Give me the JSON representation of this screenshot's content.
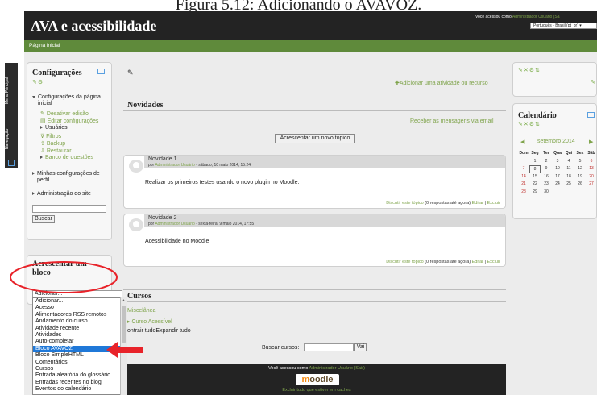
{
  "caption": "Figura 5.12: Adicionando o AVAVOZ.",
  "header": {
    "site_title": "AVA e acessibilidade",
    "login_prefix": "Você acessou como ",
    "login_user": "Administrador Usuário",
    "login_suffix": " (Sa",
    "language": "Português - Brasil (pt_br)"
  },
  "navbar": {
    "home": "Página inicial"
  },
  "side_tabs": {
    "main_menu": "Menu Principal",
    "navigation": "Navegação"
  },
  "config_block": {
    "title": "Configurações",
    "root": "Configurações da página inicial",
    "items": [
      "Desativar edição",
      "Editar configurações",
      "Usuários",
      "Filtros",
      "Backup",
      "Restaurar",
      "Banco de questões"
    ],
    "my_profile": "Minhas configurações de perfil",
    "site_admin": "Administração do site",
    "search_button": "Buscar"
  },
  "add_block": {
    "title_line1": "Acrescentar um",
    "title_line2": "bloco",
    "select_value": "Adicionar...",
    "options": [
      "Adicionar...",
      "Acesso",
      "Alimentadores RSS remotos",
      "Andamento do curso",
      "Atividade recente",
      "Atividades",
      "Auto-completar",
      "Bloco AVAVOZ",
      "Bloco SimpleHTML",
      "Comentários",
      "Cursos",
      "Entrada aleatória do glossário",
      "Entradas recentes no blog",
      "Eventos do calendário"
    ],
    "selected_option": "Bloco AVAVOZ"
  },
  "main": {
    "add_activity": "Adicionar uma atividade ou recurso",
    "news_title": "Novidades",
    "subscribe": "Receber as mensagens via email",
    "new_topic_button": "Acrescentar um novo tópico",
    "posts": [
      {
        "title": "Novidade 1",
        "by": "por ",
        "author": "Administrador Usuário",
        "date": " - sábado, 10 maio 2014, 15:24",
        "body": "Realizar os primeiros testes usando o novo plugin no Moodle.",
        "discuss": "Discutir este tópico",
        "replies": " (0 respostas até agora) ",
        "edit": "Editar",
        "delete": "Excluir"
      },
      {
        "title": "Novidade 2",
        "by": "por ",
        "author": "Administrador Usuário",
        "date": " - sexta-feira, 9 maio 2014, 17:55",
        "body": "Acessibilidade no Moodle",
        "discuss": "Discutir este tópico",
        "replies": " (0 respostas até agora) ",
        "edit": "Editar",
        "delete": "Excluir"
      }
    ],
    "courses_title": "Cursos",
    "category": "Miscelânea",
    "course": "Curso Acessível",
    "collapse_expand": "ontrair tudoExpandir tudo",
    "search_courses_label": "Buscar cursos:",
    "go_button": "Vai"
  },
  "calendar": {
    "title": "Calendário",
    "month": "setembro 2014",
    "weekdays": [
      "Dom",
      "Seg",
      "Ter",
      "Qua",
      "Qui",
      "Sex",
      "Sáb"
    ],
    "weeks": [
      [
        "",
        "1",
        "2",
        "3",
        "4",
        "5",
        "6"
      ],
      [
        "7",
        "8",
        "9",
        "10",
        "11",
        "12",
        "13"
      ],
      [
        "14",
        "15",
        "16",
        "17",
        "18",
        "19",
        "20"
      ],
      [
        "21",
        "22",
        "23",
        "24",
        "25",
        "26",
        "27"
      ],
      [
        "28",
        "29",
        "30",
        "",
        "",
        "",
        ""
      ]
    ],
    "today": "8"
  },
  "footer": {
    "login_prefix": "Você acessou como ",
    "login_user": "Administrador Usuário",
    "login_logout": " (Sair)",
    "logo": "moodle",
    "reset": "Excluir tudo que estiver em caches"
  },
  "colors": {
    "header": "#232323",
    "navbar": "#5f8a3b",
    "link": "#7ea34a",
    "selected": "#1f78d8",
    "annotation": "#e8232a"
  }
}
